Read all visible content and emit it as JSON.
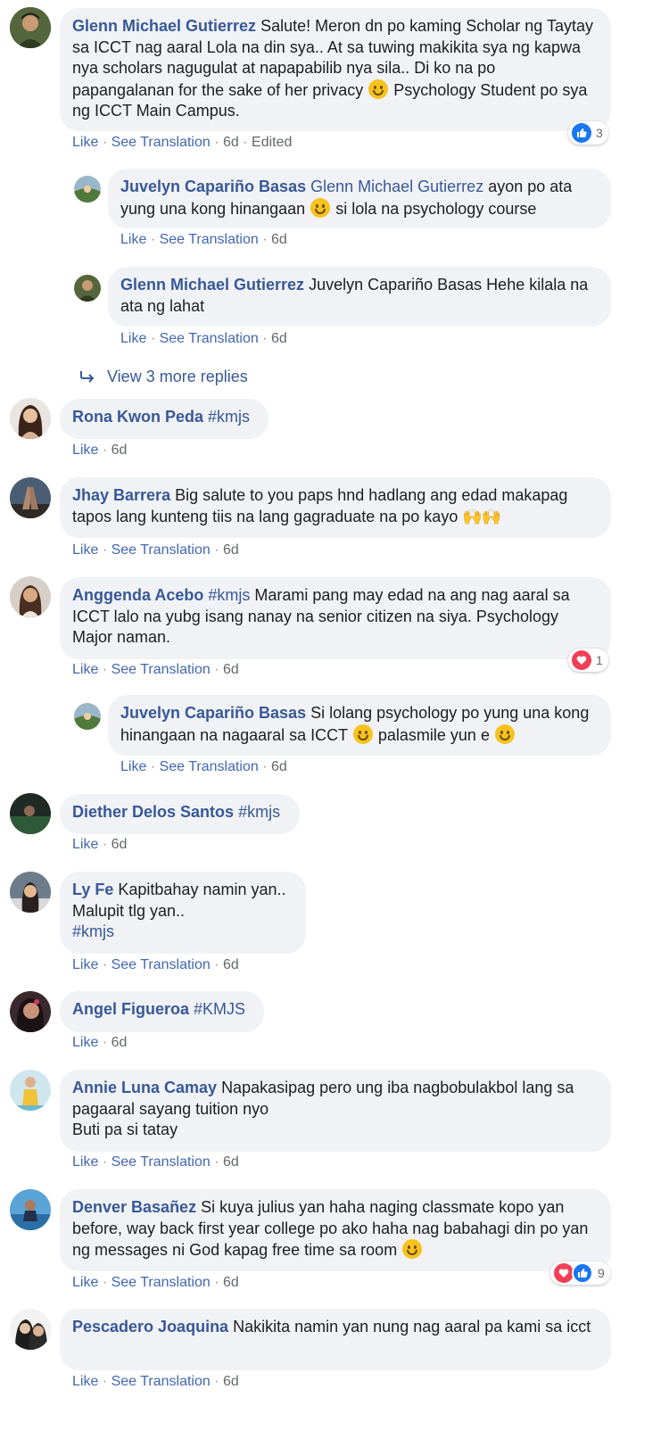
{
  "comments": [
    {
      "name": "Glenn Michael Gutierrez",
      "tag": "",
      "text": "Salute! Meron dn po kaming Scholar ng Taytay sa ICCT nag aaral Lola na din sya.. At sa tuwing makikita sya ng kapwa nya scholars nagugulat at napapabilib nya sila.. Di ko na po papangalanan for the sake of her privacy",
      "text2": "Psychology Student po sya ng ICCT Main Campus.",
      "like": "Like",
      "translate": "See Translation",
      "time": "6d",
      "edited": "Edited",
      "reaction_count": "3"
    },
    {
      "name": "Juvelyn Capariño Basas",
      "tag": "Glenn Michael Gutierrez",
      "text": "ayon po ata yung una kong hinangaan",
      "text2": "si lola na psychology course",
      "like": "Like",
      "translate": "See Translation",
      "time": "6d"
    },
    {
      "name": "Glenn Michael Gutierrez",
      "tag": "",
      "text": "Juvelyn Capariño Basas Hehe kilala na ata ng lahat",
      "like": "Like",
      "translate": "See Translation",
      "time": "6d"
    },
    {
      "name": "Rona Kwon Peda",
      "tag": "#kmjs",
      "text": "",
      "like": "Like",
      "time": "6d"
    },
    {
      "name": "Jhay Barrera",
      "tag": "",
      "text": "Big salute to you paps hnd hadlang ang edad makapag tapos lang kunteng tiis na lang gagraduate na po kayo",
      "like": "Like",
      "translate": "See Translation",
      "time": "6d"
    },
    {
      "name": "Anggenda Acebo",
      "tag": "#kmjs",
      "text": "Marami pang may edad na ang nag aaral sa ICCT lalo na yubg isang nanay na senior citizen na siya. Psychology Major naman.",
      "like": "Like",
      "translate": "See Translation",
      "time": "6d",
      "reaction_count": "1"
    },
    {
      "name": "Juvelyn Capariño Basas",
      "tag": "",
      "text": "Si lolang psychology po yung una kong hinangaan na nagaaral sa ICCT",
      "text2": "palasmile yun e",
      "like": "Like",
      "translate": "See Translation",
      "time": "6d"
    },
    {
      "name": "Diether Delos Santos",
      "tag": "#kmjs",
      "text": "",
      "like": "Like",
      "time": "6d"
    },
    {
      "name": "Ly Fe",
      "tag": "",
      "text": "Kapitbahay namin yan..",
      "text2": "Malupit tlg yan..",
      "text3": "#kmjs",
      "like": "Like",
      "translate": "See Translation",
      "time": "6d"
    },
    {
      "name": "Angel Figueroa",
      "tag": "#KMJS",
      "text": "",
      "like": "Like",
      "time": "6d"
    },
    {
      "name": "Annie Luna Camay",
      "tag": "",
      "text": "Napakasipag pero ung iba nagbobulakbol lang sa pagaaral sayang tuition nyo",
      "text2": "Buti pa si tatay",
      "like": "Like",
      "translate": "See Translation",
      "time": "6d"
    },
    {
      "name": "Denver Basañez",
      "tag": "",
      "text": "Si kuya julius yan haha naging classmate kopo yan before, way back first year college po ako haha nag babahagi din po yan ng messages ni God kapag free time sa room",
      "like": "Like",
      "translate": "See Translation",
      "time": "6d",
      "reaction_count": "9"
    },
    {
      "name": "Pescadero Joaquina",
      "tag": "",
      "text": "Nakikita namin yan nung nag aaral pa kami sa icct",
      "like": "Like",
      "translate": "See Translation",
      "time": "6d"
    }
  ],
  "view_more": "View 3 more replies",
  "separator": "·",
  "colors": {
    "bubble": "#f0f2f5",
    "name": "#385898",
    "action": "#4267b2",
    "like_blue": "#1877f2",
    "love_red": "#f33e58"
  }
}
